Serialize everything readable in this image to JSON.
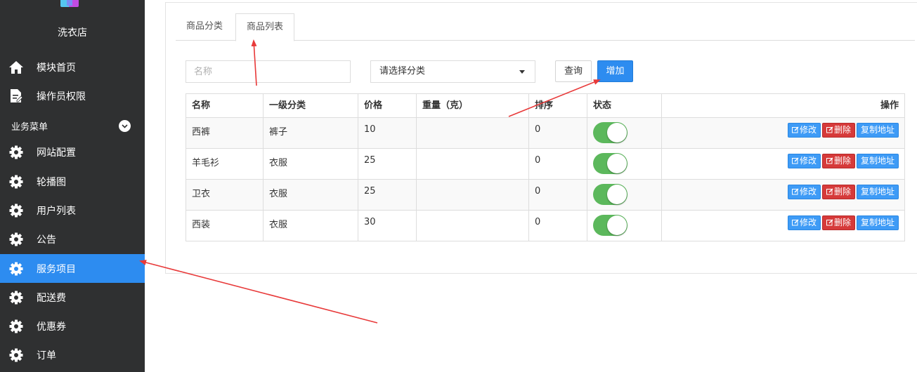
{
  "sidebar": {
    "shop_name": "洗衣店",
    "items_top": [
      {
        "label": "模块首页",
        "icon": "home-icon"
      },
      {
        "label": "操作员权限",
        "icon": "document-edit-icon"
      }
    ],
    "group_label": "业务菜单",
    "items": [
      {
        "label": "网站配置",
        "icon": "gear-icon"
      },
      {
        "label": "轮播图",
        "icon": "gear-icon"
      },
      {
        "label": "用户列表",
        "icon": "gear-icon"
      },
      {
        "label": "公告",
        "icon": "gear-icon"
      },
      {
        "label": "服务项目",
        "icon": "gear-icon",
        "active": true
      },
      {
        "label": "配送费",
        "icon": "gear-icon"
      },
      {
        "label": "优惠券",
        "icon": "gear-icon"
      },
      {
        "label": "订单",
        "icon": "gear-icon"
      }
    ]
  },
  "tabs": [
    "商品分类",
    "商品列表"
  ],
  "active_tab": "商品列表",
  "filters": {
    "name_placeholder": "名称",
    "category_placeholder": "请选择分类",
    "query_label": "查询",
    "add_label": "增加"
  },
  "table": {
    "headers": [
      "名称",
      "一级分类",
      "价格",
      "重量（克）",
      "排序",
      "状态",
      "操作"
    ],
    "rows": [
      {
        "name": "西裤",
        "category": "裤子",
        "price": "10",
        "weight": "",
        "sort": "0",
        "status": "on"
      },
      {
        "name": "羊毛衫",
        "category": "衣服",
        "price": "25",
        "weight": "",
        "sort": "0",
        "status": "on"
      },
      {
        "name": "卫衣",
        "category": "衣服",
        "price": "25",
        "weight": "",
        "sort": "0",
        "status": "on"
      },
      {
        "name": "西装",
        "category": "衣服",
        "price": "30",
        "weight": "",
        "sort": "0",
        "status": "on"
      }
    ],
    "actions": {
      "edit": "修改",
      "delete": "删除",
      "copy": "复制地址"
    }
  },
  "colors": {
    "sidebar_bg": "#2f3031",
    "active_blue": "#2d8cf0",
    "toggle_on": "#5cb85c",
    "delete_red": "#d63a3a",
    "annotation_red": "#e83a3a"
  }
}
